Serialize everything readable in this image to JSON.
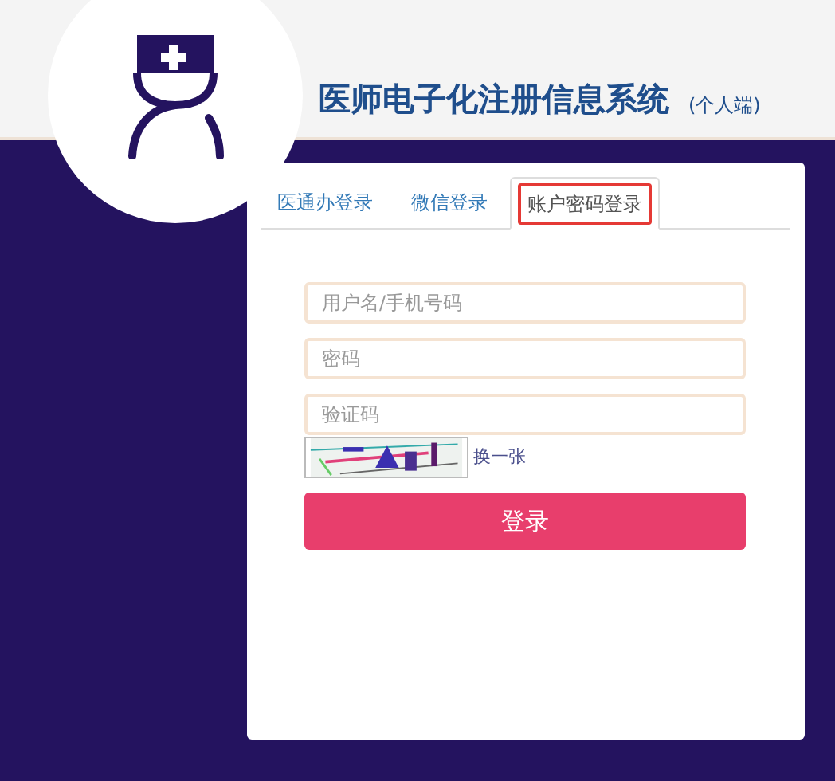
{
  "header": {
    "title": "医师电子化注册信息系统",
    "subtitle": "(个人端)"
  },
  "tabs": [
    {
      "label": "医通办登录",
      "selected": false
    },
    {
      "label": "微信登录",
      "selected": false
    },
    {
      "label": "账户密码登录",
      "selected": true
    }
  ],
  "form": {
    "fields": [
      {
        "placeholder": "用户名/手机号码"
      },
      {
        "placeholder": "密码"
      },
      {
        "placeholder": "验证码"
      }
    ],
    "captcha": {
      "kind": "picture",
      "refresh_link": "换一张"
    },
    "submit": "登录"
  }
}
